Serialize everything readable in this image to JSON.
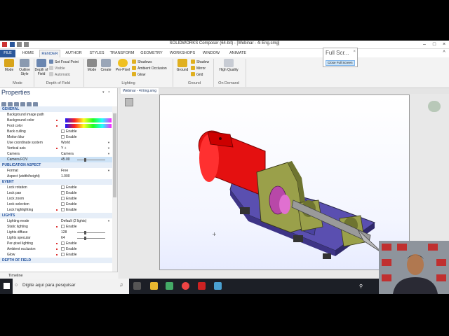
{
  "window": {
    "title": "SOLIDWORKS Composer (64-bit) - [Webinar - 4i Eng.smg]"
  },
  "tabs": [
    "FILE",
    "HOME",
    "RENDER",
    "AUTHOR",
    "STYLES",
    "TRANSFORM",
    "GEOMETRY",
    "WORKSHOPS",
    "WINDOW",
    "ANIMATE"
  ],
  "active_tab": "RENDER",
  "ribbon": {
    "mode_group": {
      "label": "Mode",
      "buttons": [
        "Mode",
        "Outline Style"
      ]
    },
    "dof_group": {
      "label": "Depth of Field",
      "button": "Depth of Field",
      "items": [
        "Set Focal Point",
        "Visible",
        "Automatic"
      ]
    },
    "lighting_group": {
      "label": "Lighting",
      "buttons": [
        "Mode",
        "Create",
        "Per-Pixel"
      ],
      "items": [
        "Shadows",
        "Ambient Occlusion",
        "Glow"
      ]
    },
    "ground_group": {
      "label": "Ground",
      "button": "Ground",
      "items": [
        "Shadow",
        "Mirror",
        "Grid"
      ]
    },
    "ondemand_group": {
      "label": "On Demand",
      "button": "High Quality"
    }
  },
  "fullscreen_popup": {
    "title": "Full Scr...",
    "close": "×",
    "button": "Close Full Screen"
  },
  "properties": {
    "title": "Properties",
    "rows": [
      {
        "type": "section",
        "label": "GENERAL"
      },
      {
        "name": "Background image path",
        "value": ""
      },
      {
        "name": "Background color",
        "value": "",
        "red": true,
        "gradient": true
      },
      {
        "name": "Foot color",
        "value": "",
        "red": true,
        "gradient": true
      },
      {
        "name": "Back culling",
        "value": "Enable",
        "check": true
      },
      {
        "name": "Motion blur",
        "value": "Enable",
        "check": true
      },
      {
        "name": "Use coordinate system",
        "value": "World",
        "dd": true
      },
      {
        "name": "Vertical axis",
        "value": "Y +",
        "red": true,
        "dd": true
      },
      {
        "name": "Camera",
        "value": "Camera",
        "dd": true
      },
      {
        "name": "Camera FOV",
        "value": "45.00",
        "selected": true,
        "slider": true
      },
      {
        "type": "section",
        "label": "PUBLICATION ASPECT"
      },
      {
        "name": "Format",
        "value": "Free",
        "dd": true
      },
      {
        "name": "Aspect (width/height)",
        "value": "1.000"
      },
      {
        "type": "section",
        "label": "EVENT"
      },
      {
        "name": "Lock rotation",
        "value": "Enable",
        "check": true
      },
      {
        "name": "Lock pan",
        "value": "Enable",
        "check": true
      },
      {
        "name": "Lock zoom",
        "value": "Enable",
        "check": true
      },
      {
        "name": "Lock selection",
        "value": "Enable",
        "check": true
      },
      {
        "name": "Lock highlighting",
        "value": "Enable",
        "red": true,
        "check": true
      },
      {
        "type": "section",
        "label": "LIGHTS"
      },
      {
        "name": "Lighting mode",
        "value": "Default (2 lights)",
        "dd": true
      },
      {
        "name": "Static lighting",
        "value": "Enable",
        "red": true,
        "check": true
      },
      {
        "name": "Lights diffuse",
        "value": "128",
        "slider": true
      },
      {
        "name": "Lights specular",
        "value": "64",
        "slider": true
      },
      {
        "name": "Per-pixel lighting",
        "value": "Enable",
        "red": true,
        "check": true
      },
      {
        "name": "Ambient occlusion",
        "value": "Enable",
        "red": true,
        "check": true
      },
      {
        "name": "Glow",
        "value": "Enable",
        "red": true,
        "check": true
      },
      {
        "type": "section",
        "label": "DEPTH OF FIELD"
      }
    ]
  },
  "timeline": {
    "label": "Timeline"
  },
  "viewport": {
    "tab": "Webinar - 4i Eng.smg"
  },
  "taskbar": {
    "search_placeholder": "Digite aqui para pesquisar"
  },
  "colors": {
    "accent": "#2b579a",
    "motor": "#e41010",
    "base": "#5a4fb0",
    "bracket": "#9aa04a"
  }
}
